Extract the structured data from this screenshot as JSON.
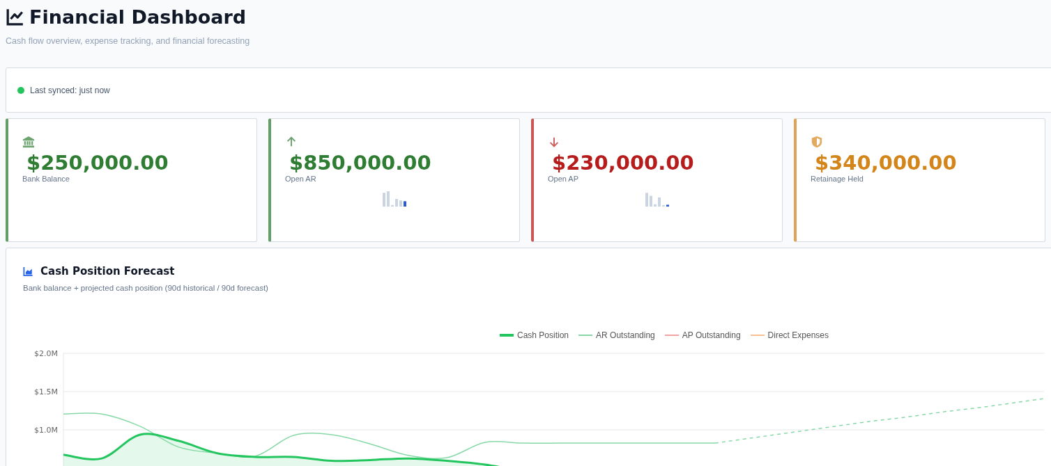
{
  "header": {
    "title": "Financial Dashboard",
    "subtitle": "Cash flow overview, expense tracking, and financial forecasting"
  },
  "sync": {
    "text": "Last synced: just now",
    "color": "#22c55e"
  },
  "metrics": [
    {
      "kind": "bank",
      "value": "$250,000.00",
      "label": "Bank Balance",
      "color": "#2e7d32",
      "trend_bars": false
    },
    {
      "kind": "arrow-up",
      "value": "$850,000.00",
      "label": "Open AR",
      "color": "#2e7d32",
      "trend_bars": true
    },
    {
      "kind": "arrow-down",
      "value": "$230,000.00",
      "label": "Open AP",
      "color": "#b71c1c",
      "trend_bars": true
    },
    {
      "kind": "shield",
      "value": "$340,000.00",
      "label": "Retainage Held",
      "color": "#d4851a",
      "trend_bars": false
    }
  ],
  "forecast": {
    "title": "Cash Position Forecast",
    "subtitle": "Bank balance + projected cash position (90d historical / 90d forecast)",
    "legend": [
      {
        "name": "Cash Position",
        "color": "#22c55e"
      },
      {
        "name": "AR Outstanding",
        "color": "#86d9a6"
      },
      {
        "name": "AP Outstanding",
        "color": "#f4a3a3"
      },
      {
        "name": "Direct Expenses",
        "color": "#f7bf94"
      }
    ],
    "y_axis_labels": [
      "$2.0M",
      "$1.5M",
      "$1.0M"
    ]
  }
}
